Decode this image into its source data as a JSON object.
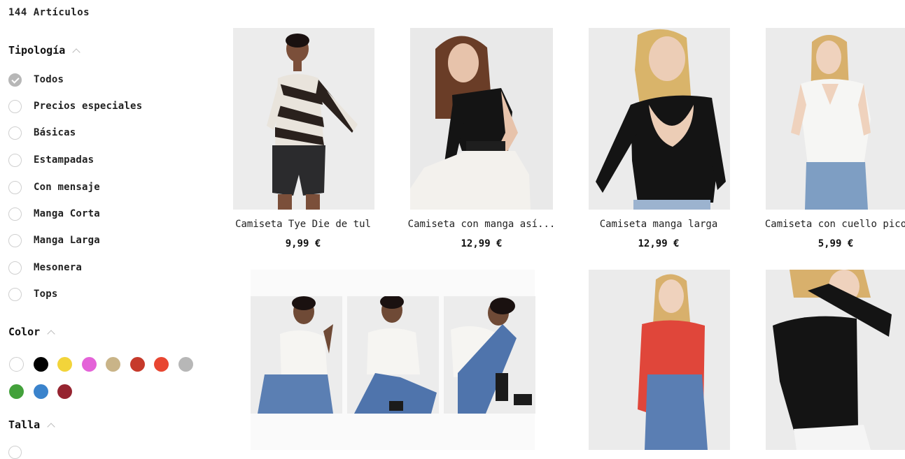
{
  "results_count": "144 Artículos",
  "filters": {
    "tipologia": {
      "title": "Tipología",
      "options": [
        "Todos",
        "Precios especiales",
        "Básicas",
        "Estampadas",
        "Con mensaje",
        "Manga Corta",
        "Manga Larga",
        "Mesonera",
        "Tops"
      ],
      "selected": "Todos"
    },
    "color": {
      "title": "Color",
      "swatches": [
        "#ffffff",
        "#000000",
        "#f2d43a",
        "#e463d8",
        "#c9b488",
        "#c63a2b",
        "#e84631",
        "#b7b7b7",
        "#43a13b",
        "#3a83cc",
        "#962430"
      ]
    },
    "talla": {
      "title": "Talla"
    }
  },
  "products": [
    {
      "name": "Camiseta Tye Die de tul",
      "price": "9,99 €"
    },
    {
      "name": "Camiseta con manga así...",
      "price": "12,99 €"
    },
    {
      "name": "Camiseta manga larga",
      "price": "12,99 €"
    },
    {
      "name": "Camiseta con cuello pico",
      "price": "5,99 €"
    }
  ]
}
